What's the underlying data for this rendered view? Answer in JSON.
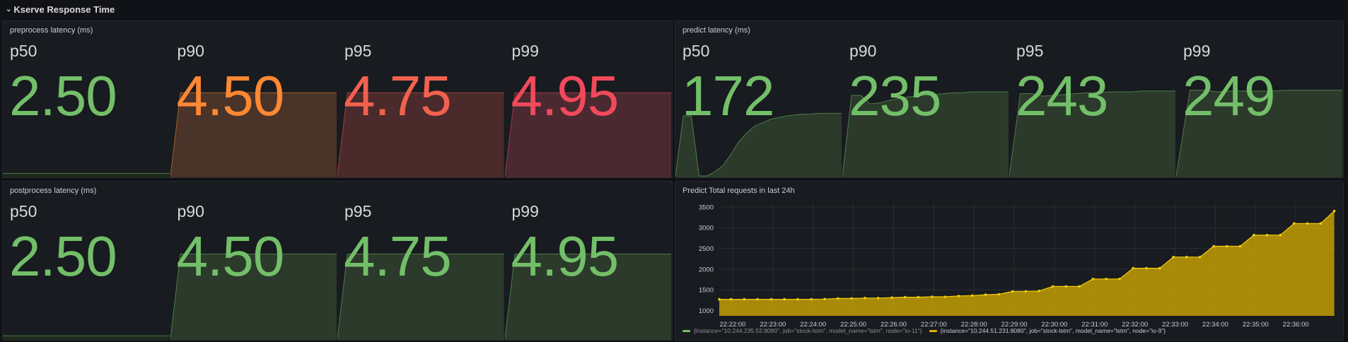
{
  "row": {
    "title": "Kserve Response Time"
  },
  "colors": {
    "green": "#73bf69",
    "orange": "#ff8833",
    "red_orange": "#f2614f",
    "red": "#f2495c",
    "yellow": "#e0b400"
  },
  "panels": {
    "preprocess": {
      "title": "preprocess latency (ms)",
      "stats": [
        {
          "name": "p50",
          "value": "2.50",
          "color": "#73bf69",
          "fill": "#1c2a1b",
          "spark": [
            0.03,
            0.03,
            0.03,
            0.03
          ]
        },
        {
          "name": "p90",
          "value": "4.50",
          "color": "#ff8833",
          "fill": "#4a3328",
          "spark": [
            0.0,
            0.97,
            0.97,
            0.97
          ]
        },
        {
          "name": "p95",
          "value": "4.75",
          "color": "#f2614f",
          "fill": "#4a2a2a",
          "spark": [
            0.0,
            0.97,
            0.97,
            0.97
          ]
        },
        {
          "name": "p99",
          "value": "4.95",
          "color": "#f2495c",
          "fill": "#4a2a30",
          "spark": [
            0.0,
            0.97,
            0.97,
            0.97
          ]
        }
      ]
    },
    "predict": {
      "title": "predict latency (ms)",
      "stats": [
        {
          "name": "p50",
          "value": "172",
          "color": "#73bf69",
          "fill": "#2b3a2a",
          "spark": [
            0.0,
            0.7,
            0.7,
            0.0,
            0.0,
            0.05,
            0.12,
            0.25,
            0.4,
            0.5,
            0.58,
            0.62,
            0.66,
            0.68,
            0.7,
            0.71,
            0.72,
            0.72,
            0.73,
            0.73,
            0.73,
            0.73
          ]
        },
        {
          "name": "p90",
          "value": "235",
          "color": "#73bf69",
          "fill": "#2b3a2a",
          "spark": [
            0.0,
            0.94,
            0.94,
            0.84,
            0.85,
            0.88,
            0.9,
            0.92,
            0.93,
            0.94,
            0.95,
            0.96,
            0.97,
            0.97,
            0.98,
            0.98,
            0.98,
            0.98,
            0.98
          ]
        },
        {
          "name": "p95",
          "value": "243",
          "color": "#73bf69",
          "fill": "#2b3a2a",
          "spark": [
            0.0,
            0.96,
            0.96,
            0.93,
            0.94,
            0.95,
            0.96,
            0.97,
            0.97,
            0.98,
            0.98,
            0.98,
            0.99,
            0.99,
            0.99,
            0.99
          ]
        },
        {
          "name": "p99",
          "value": "249",
          "color": "#73bf69",
          "fill": "#2b3a2a",
          "spark": [
            0.0,
            1.0,
            1.0,
            0.98,
            0.99,
            0.99,
            0.99,
            0.99,
            1.0,
            1.0,
            1.0,
            1.0,
            1.0
          ]
        }
      ]
    },
    "postprocess": {
      "title": "postprocess latency (ms)",
      "stats": [
        {
          "name": "p50",
          "value": "2.50",
          "color": "#73bf69",
          "fill": "#1c2a1b",
          "spark": [
            0.03,
            0.03,
            0.03,
            0.03
          ]
        },
        {
          "name": "p90",
          "value": "4.50",
          "color": "#73bf69",
          "fill": "#2b3a2a",
          "spark": [
            0.0,
            0.97,
            0.97,
            0.97
          ]
        },
        {
          "name": "p95",
          "value": "4.75",
          "color": "#73bf69",
          "fill": "#2b3a2a",
          "spark": [
            0.0,
            0.97,
            0.97,
            0.97
          ]
        },
        {
          "name": "p99",
          "value": "4.95",
          "color": "#73bf69",
          "fill": "#2b3a2a",
          "spark": [
            0.0,
            0.97,
            0.97,
            0.97
          ]
        }
      ]
    },
    "requests": {
      "title": "Predict Total requests in last 24h",
      "legend": [
        {
          "label": "{instance=\"10.244.235.52:8080\", job=\"stock-lstm\", model_name=\"lstm\", node=\"io-11\"}",
          "color": "#73bf69",
          "active": false
        },
        {
          "label": "{instance=\"10.244.51.231:8080\", job=\"stock-lstm\", model_name=\"lstm\", node=\"io-9\"}",
          "color": "#e0b400",
          "active": true
        }
      ]
    }
  },
  "chart_data": {
    "type": "area",
    "title": "Predict Total requests in last 24h",
    "xlabel": "",
    "ylabel": "",
    "x_ticks": [
      "22:22:00",
      "22:23:00",
      "22:24:00",
      "22:25:00",
      "22:26:00",
      "22:27:00",
      "22:28:00",
      "22:29:00",
      "22:30:00",
      "22:31:00",
      "22:32:00",
      "22:33:00",
      "22:34:00",
      "22:35:00",
      "22:36:00"
    ],
    "y_ticks": [
      1000,
      1500,
      2000,
      2500,
      3000,
      3500
    ],
    "ylim": [
      870,
      3600
    ],
    "xlim_minutes": [
      0,
      15.35
    ],
    "grid": true,
    "legend_position": "bottom-left",
    "series": [
      {
        "name": "{instance=\"10.244.51.231:8080\", job=\"stock-lstm\", model_name=\"lstm\", node=\"io-9\"}",
        "color": "#e0b400",
        "x_minutes_from_22_21_40": [
          0.0,
          0.29,
          0.62,
          0.95,
          1.29,
          1.62,
          1.95,
          2.29,
          2.62,
          2.95,
          3.29,
          3.62,
          3.95,
          4.29,
          4.62,
          4.95,
          5.29,
          5.62,
          5.95,
          6.29,
          6.62,
          6.95,
          7.29,
          7.62,
          7.95,
          8.29,
          8.62,
          8.95,
          9.29,
          9.62,
          9.95,
          10.29,
          10.62,
          10.95,
          11.29,
          11.62,
          11.95,
          12.29,
          12.62,
          12.95,
          13.29,
          13.62,
          13.95,
          14.29,
          14.62,
          14.95,
          15.29
        ],
        "values": [
          1270,
          1270,
          1270,
          1270,
          1270,
          1270,
          1270,
          1270,
          1275,
          1290,
          1290,
          1300,
          1300,
          1310,
          1320,
          1320,
          1330,
          1330,
          1350,
          1360,
          1380,
          1390,
          1460,
          1460,
          1470,
          1580,
          1580,
          1580,
          1760,
          1760,
          1760,
          2020,
          2020,
          2020,
          2290,
          2290,
          2290,
          2550,
          2550,
          2550,
          2820,
          2820,
          2820,
          3100,
          3100,
          3100,
          3400
        ]
      }
    ]
  }
}
